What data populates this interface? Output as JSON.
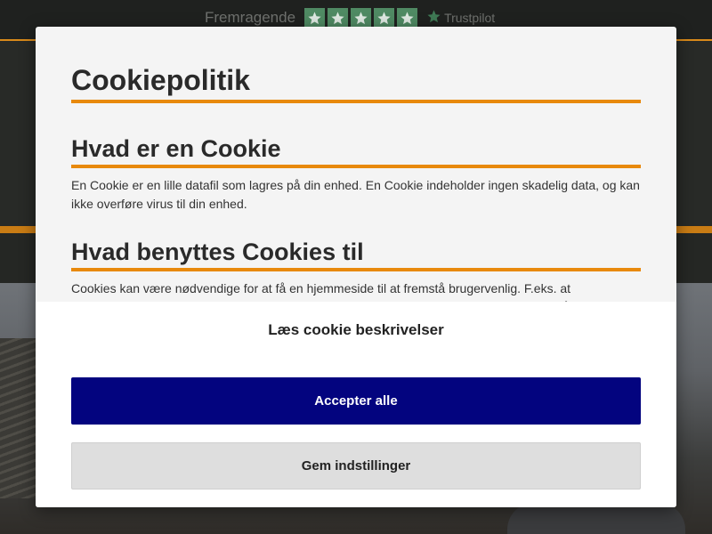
{
  "background": {
    "trustpilot": {
      "rating_text": "Fremragende",
      "stars": 5,
      "brand": "Trustpilot",
      "star_color": "#4f8a63"
    },
    "accent_color": "#d98a1a"
  },
  "modal": {
    "title": "Cookiepolitik",
    "sections": [
      {
        "heading": "Hvad er en Cookie",
        "body": "En Cookie er en lille datafil som lagres på din enhed. En Cookie indeholder ingen skadelig data, og kan ikke overføre virus til din enhed."
      },
      {
        "heading": "Hvad benyttes Cookies til",
        "body": "Cookies kan være nødvendige for at få en hjemmeside til at fremstå brugervenlig. F.eks. at hjemmesiden husker din kurv, eller hvordan listen af produkter vises. Cookies bruges også til at indsamle information"
      }
    ],
    "read_descriptions": "Læs cookie beskrivelser",
    "accept_all": "Accepter alle",
    "save_settings": "Gem indstillinger",
    "colors": {
      "accent_underline": "#e8890c",
      "accept_button": "#03047f",
      "save_button": "#dedede"
    }
  }
}
